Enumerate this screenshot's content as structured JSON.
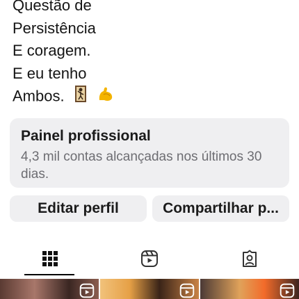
{
  "bio": {
    "lines": [
      "Questão de",
      "Persistência",
      "E coragem.",
      "E eu tenho",
      "Ambos."
    ],
    "emojis": [
      "person-climbing-icon",
      "flexed-biceps-icon"
    ]
  },
  "professional_panel": {
    "title": "Painel profissional",
    "subtitle": "4,3 mil contas alcançadas nos últimos 30 dias."
  },
  "buttons": {
    "edit_profile": "Editar perfil",
    "share_profile": "Compartilhar p..."
  },
  "tabs": [
    {
      "icon": "grid-icon",
      "active": true
    },
    {
      "icon": "reels-icon",
      "active": false
    },
    {
      "icon": "tagged-icon",
      "active": false
    }
  ],
  "thumbnails": [
    {
      "icon": "reels-icon"
    },
    {
      "icon": "reels-icon"
    },
    {
      "icon": "reels-icon"
    }
  ]
}
